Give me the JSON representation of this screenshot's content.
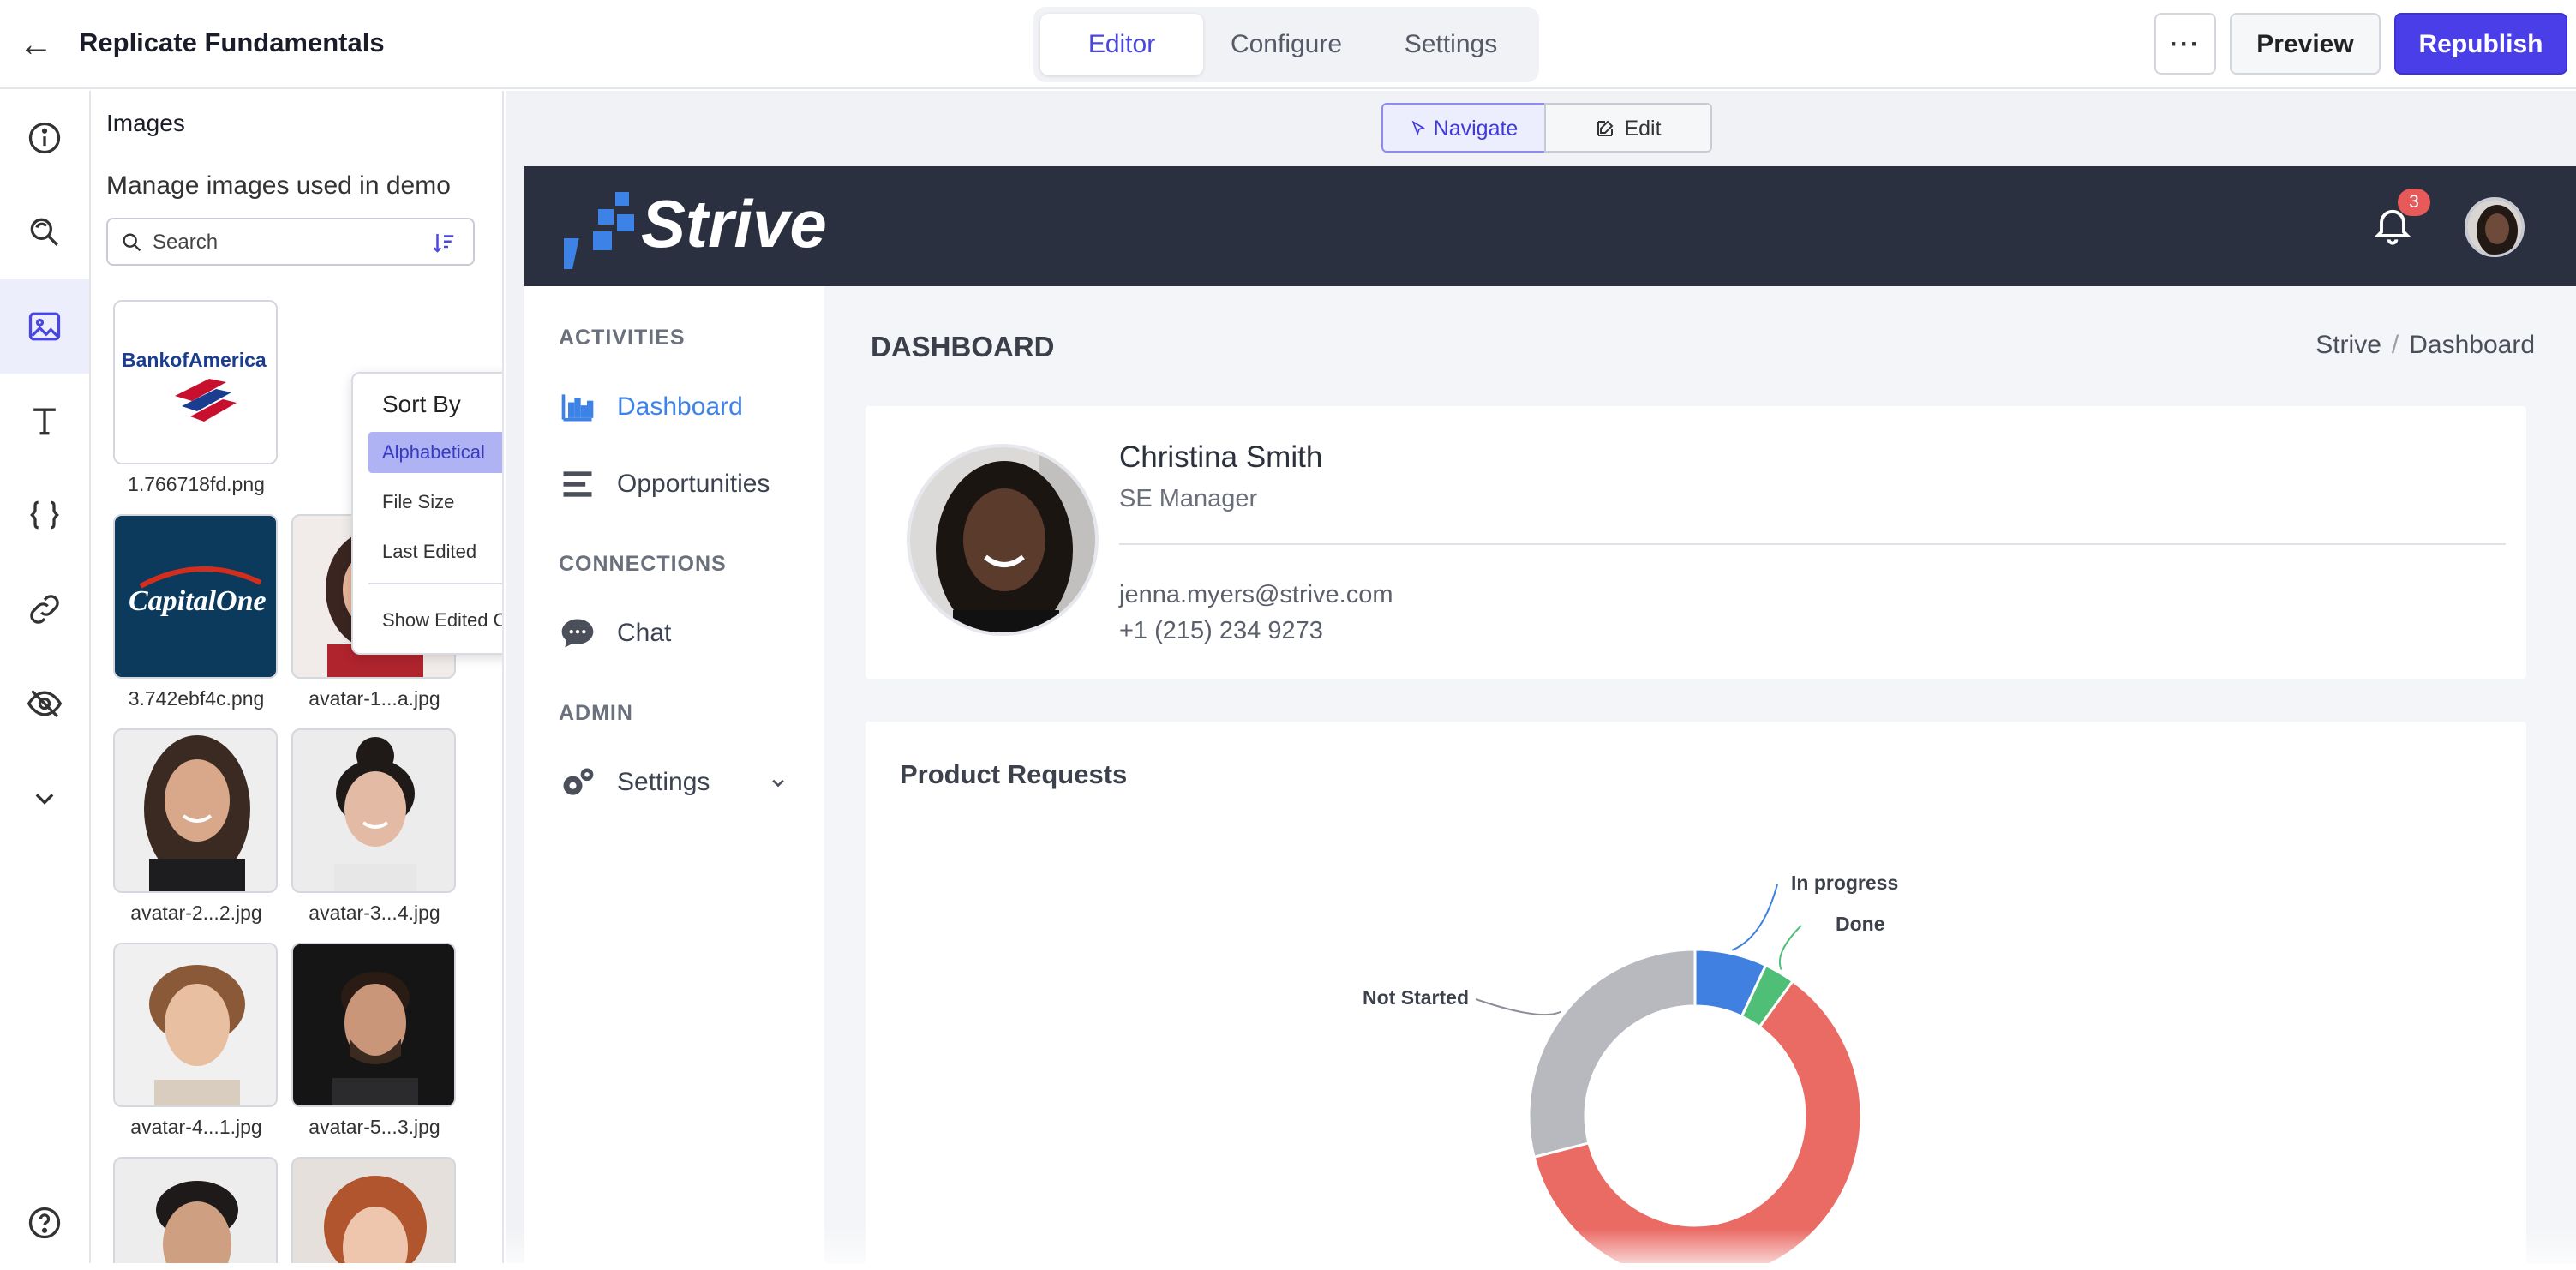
{
  "header": {
    "title": "Replicate Fundamentals",
    "tabs": [
      "Editor",
      "Configure",
      "Settings"
    ],
    "active_tab": "Editor",
    "more_label": "···",
    "preview_label": "Preview",
    "publish_label": "Republish"
  },
  "rail": {
    "items": [
      "info-icon",
      "search-refresh-icon",
      "image-icon",
      "text-icon",
      "code-braces-icon",
      "link-icon",
      "eye-off-icon",
      "chevron-down-icon",
      "help-icon"
    ],
    "active": "image-icon"
  },
  "images_panel": {
    "title": "Images",
    "subtitle": "Manage images used in demo",
    "search_placeholder": "Search",
    "thumbnails": [
      {
        "caption": "1.766718fd.png"
      },
      {
        "caption": "3.742ebf4c.png"
      },
      {
        "caption": "avatar-1...a.jpg"
      },
      {
        "caption": "avatar-2...2.jpg"
      },
      {
        "caption": "avatar-3...4.jpg"
      },
      {
        "caption": "avatar-4...1.jpg"
      },
      {
        "caption": "avatar-5...3.jpg"
      }
    ],
    "logo_text_boa": "BankofAmerica",
    "logo_text_capone": "CapitalOne"
  },
  "sort_menu": {
    "heading": "Sort By",
    "options": [
      "Alphabetical",
      "File Size",
      "Last Edited"
    ],
    "selected": "Alphabetical",
    "extra": "Show Edited Only"
  },
  "stage": {
    "navigate_label": "Navigate",
    "edit_label": "Edit"
  },
  "demo_app": {
    "brand": "Strive",
    "notifications": "3",
    "nav": {
      "sections": [
        {
          "title": "ACTIVITIES",
          "items": [
            "Dashboard",
            "Opportunities"
          ]
        },
        {
          "title": "CONNECTIONS",
          "items": [
            "Chat"
          ]
        },
        {
          "title": "ADMIN",
          "items": [
            "Settings"
          ]
        }
      ],
      "active": "Dashboard"
    },
    "page_title": "DASHBOARD",
    "breadcrumb": [
      "Strive",
      "Dashboard"
    ],
    "breadcrumb_sep": "/",
    "profile": {
      "name": "Christina Smith",
      "role": "SE Manager",
      "email": "jenna.myers@strive.com",
      "phone": "+1 (215) 234 9273"
    },
    "chart_title": "Product Requests"
  },
  "colors": {
    "accent": "#4a3ee8",
    "app_header": "#2b3040",
    "in_progress": "#3f80e0",
    "done": "#4fbf78",
    "remaining": "#ea6a64",
    "not_started": "#b7b9bf"
  },
  "chart_data": {
    "type": "pie",
    "title": "Product Requests",
    "donut": true,
    "labels": [
      "In progress",
      "Done",
      "",
      "Not Started"
    ],
    "values": [
      7,
      3,
      61,
      29
    ],
    "colors": [
      "#3f80e0",
      "#4fbf78",
      "#ea6a64",
      "#b7b9bf"
    ]
  }
}
